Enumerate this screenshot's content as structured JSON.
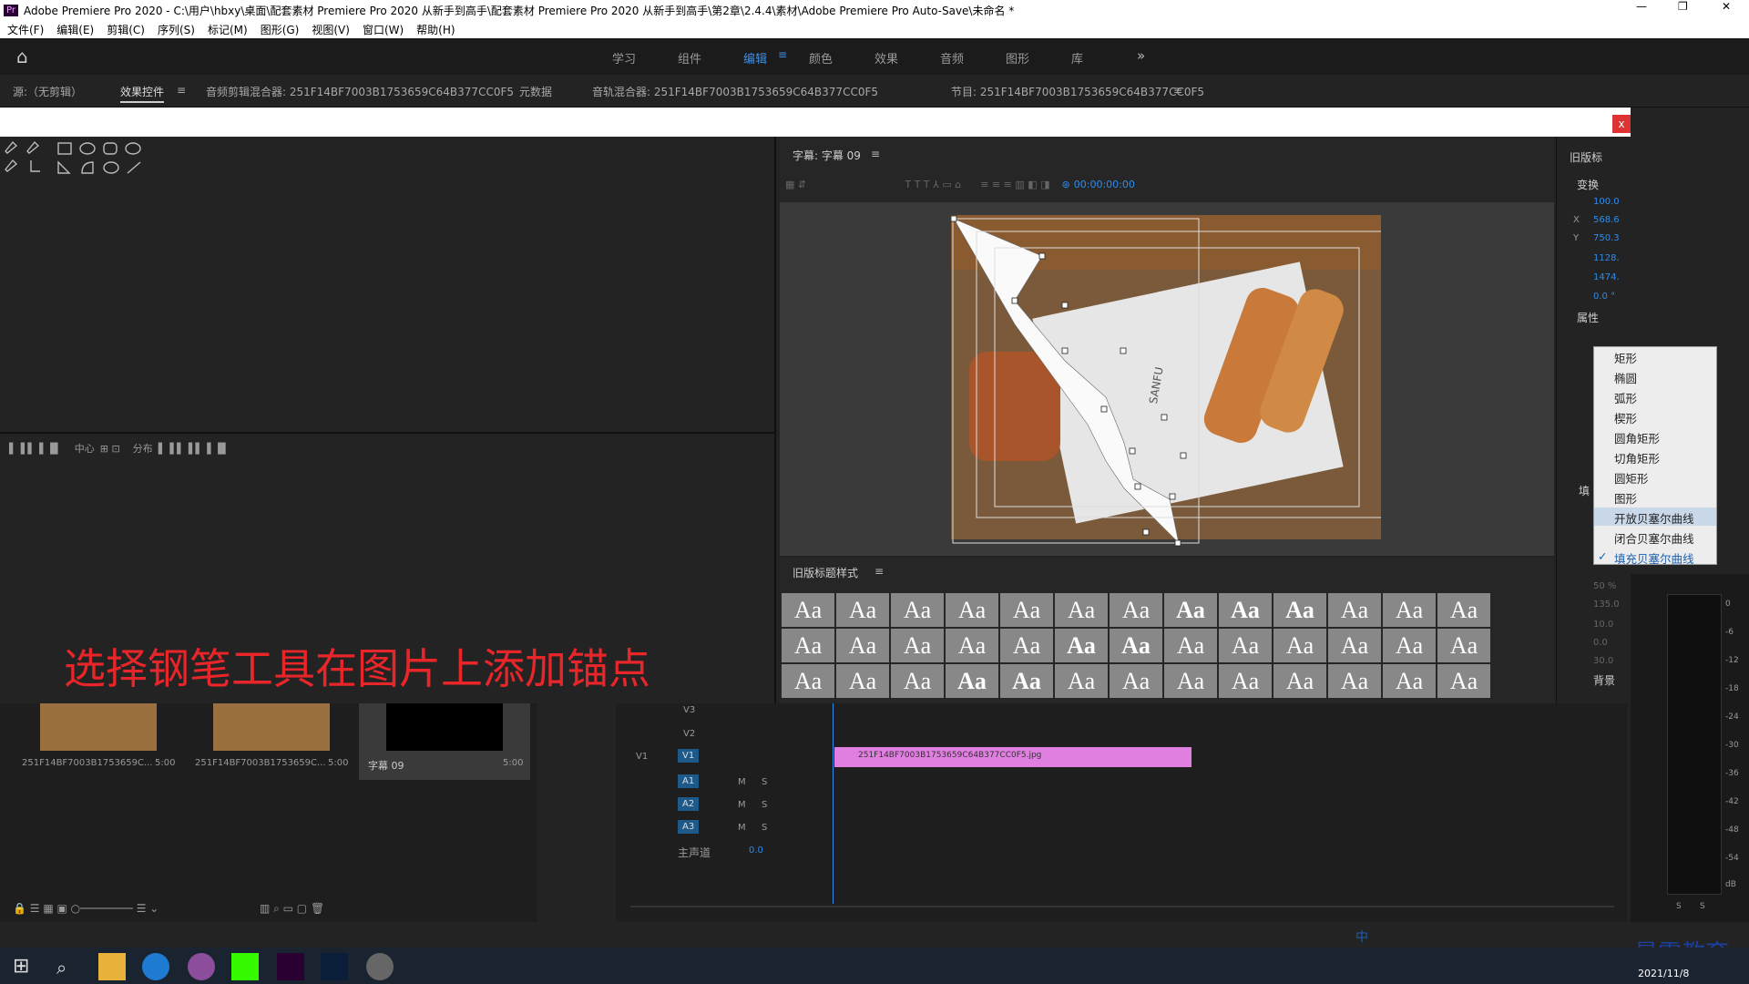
{
  "window": {
    "title": "Adobe Premiere Pro 2020 - C:\\用户\\hbxy\\桌面\\配套素材 Premiere Pro 2020 从新手到高手\\配套素材 Premiere Pro 2020 从新手到高手\\第2章\\2.4.4\\素材\\Adobe Premiere Pro Auto-Save\\未命名 *",
    "app_icon": "Pr"
  },
  "menu": [
    "文件(F)",
    "编辑(E)",
    "剪辑(C)",
    "序列(S)",
    "标记(M)",
    "图形(G)",
    "视图(V)",
    "窗口(W)",
    "帮助(H)"
  ],
  "workspaces": [
    "学习",
    "组件",
    "编辑",
    "颜色",
    "效果",
    "音频",
    "图形",
    "库"
  ],
  "workspace_active": "编辑",
  "panels": {
    "source": "源:（无剪辑）",
    "effect_controls": "效果控件",
    "audio_clip_mixer": "音频剪辑混合器: 251F14BF7003B1753659C64B377CC0F5",
    "metadata": "元数据",
    "audio_track_mixer": "音轨混合器: 251F14BF7003B1753659C64B377CC0F5",
    "program": "节目: 251F14BF7003B1753659C64B377CC0F5",
    "close_x": "x"
  },
  "titler": {
    "caption": "字幕: 字幕 09",
    "timecode": "00:00:00:00",
    "styles_title": "旧版标题样式",
    "align_labels": [
      "中心",
      "分布"
    ],
    "sanfu": "SANFU"
  },
  "instruction": "选择钢笔工具在图片上添加锚点",
  "properties": {
    "title": "旧版标",
    "transform": "变换",
    "values": [
      "100.0",
      "568.6",
      "750.3",
      "1128.",
      "1474.",
      "0.0 °"
    ],
    "xlabel": "X",
    "ylabel": "Y",
    "attributes": "属性",
    "fill": "填",
    "background": "背景",
    "extra_values": [
      "50 %",
      "135.0",
      "10.0",
      "0.0",
      "30.0"
    ]
  },
  "dropdown": {
    "items": [
      "矩形",
      "椭圆",
      "弧形",
      "楔形",
      "圆角矩形",
      "切角矩形",
      "圆矩形",
      "图形",
      "开放贝塞尔曲线",
      "闭合贝塞尔曲线",
      "填充贝塞尔曲线"
    ],
    "hovered": "开放贝塞尔曲线",
    "checked": "填充贝塞尔曲线"
  },
  "project": {
    "items": [
      {
        "name": "251F14BF7003B1753659C...",
        "duration": "5:00"
      },
      {
        "name": "251F14BF7003B1753659C...",
        "duration": "5:00"
      },
      {
        "name": "字幕 09",
        "duration": "5:00"
      }
    ]
  },
  "timeline": {
    "tracks": [
      "V3",
      "V2",
      "V1",
      "A1",
      "A2",
      "A3"
    ],
    "v1_source": "V1",
    "master": "主声道",
    "master_value": "0.0",
    "clip": "251F14BF7003B1753659C64B377CC0F5.jpg",
    "m": "M",
    "s": "S"
  },
  "meters": [
    "0",
    "-6",
    "-12",
    "-18",
    "-24",
    "-30",
    "-36",
    "-42",
    "-48",
    "-54",
    "dB"
  ],
  "meter_solo": [
    "S",
    "S"
  ],
  "watermark": {
    "brand": "最需教育",
    "date": "2021/11/8"
  },
  "taskbar": {
    "ime": "中"
  },
  "colors": {
    "accent": "#2d8ceb",
    "clip": "#e07fe0",
    "warning_text": "#e8262a"
  }
}
